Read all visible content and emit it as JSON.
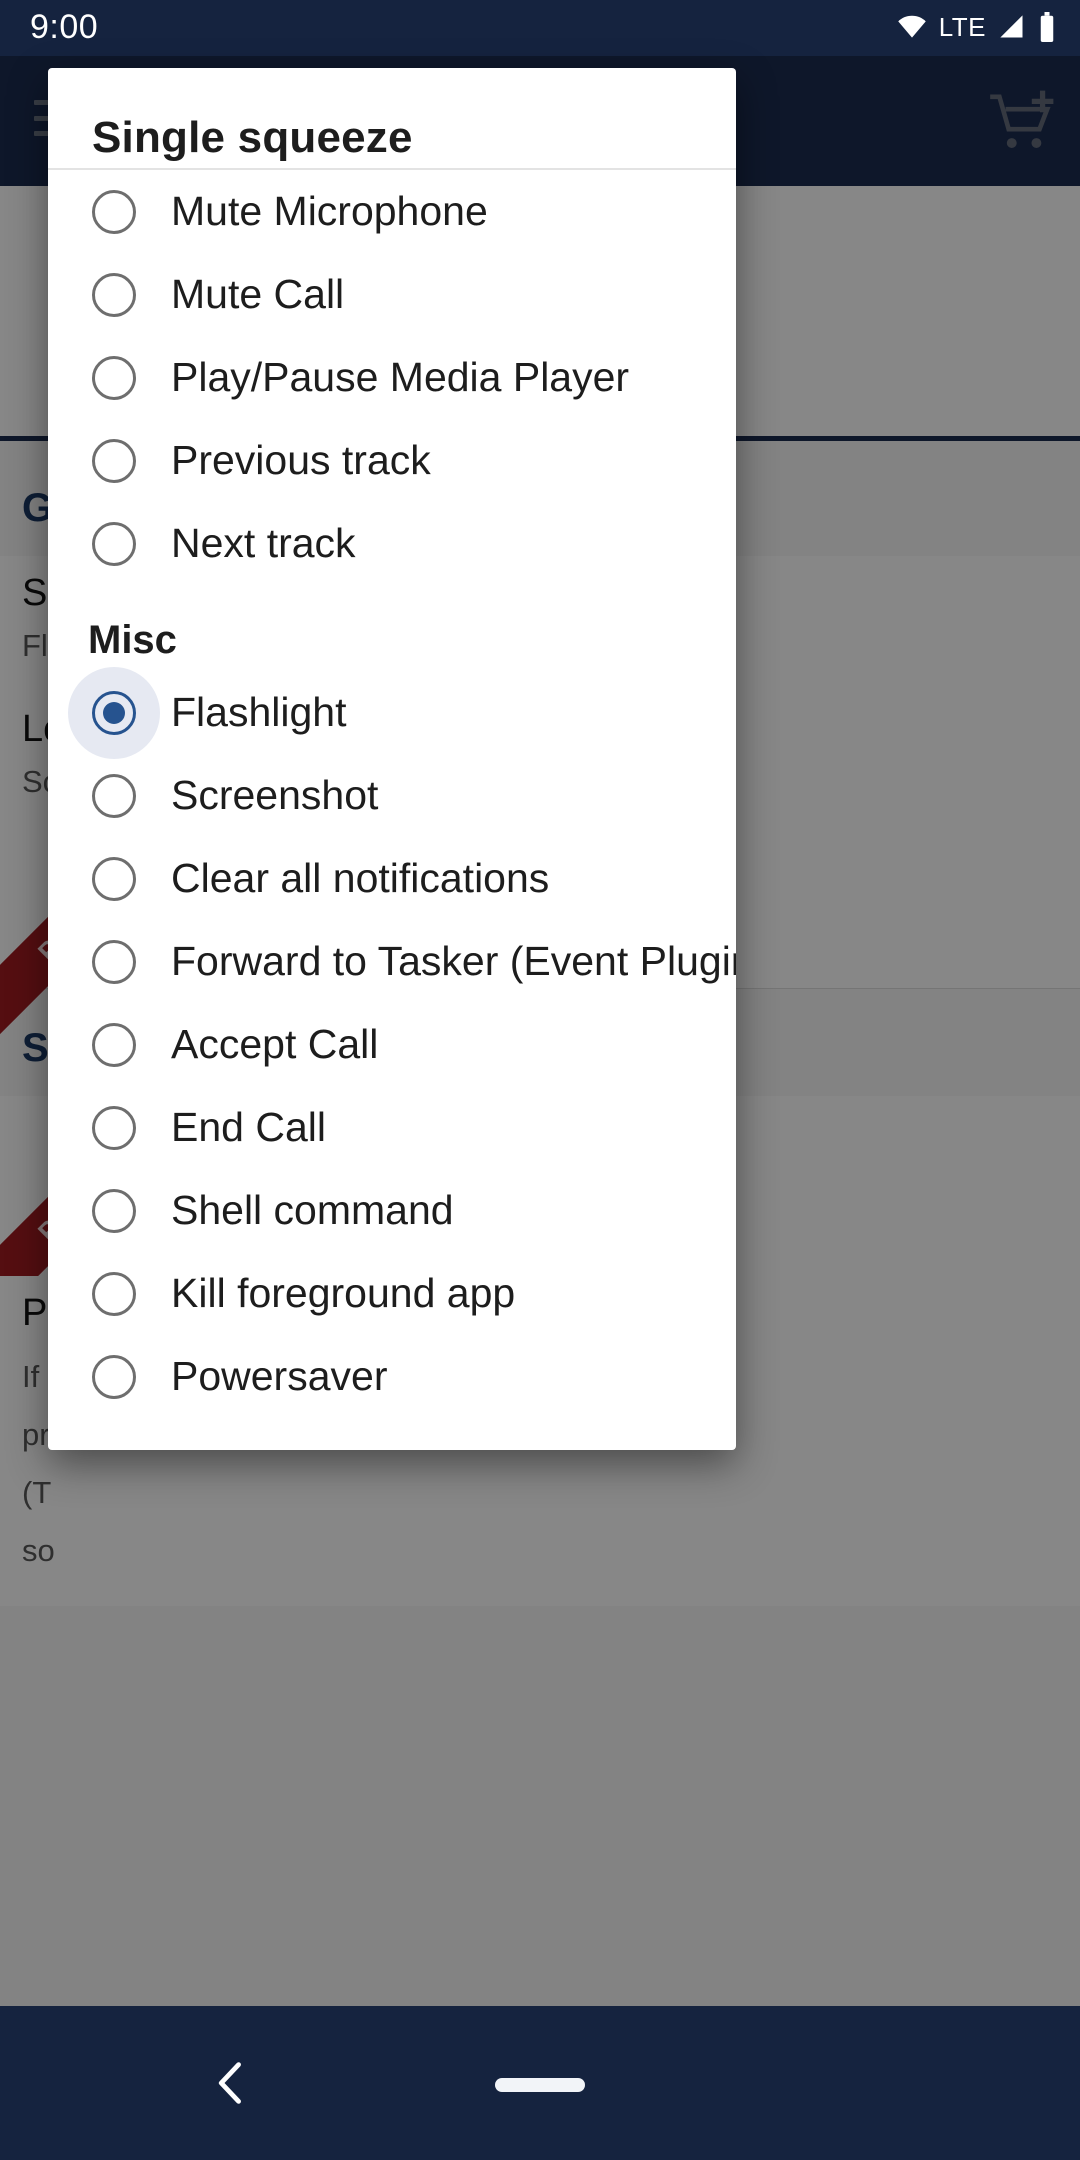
{
  "status_bar": {
    "time": "9:00",
    "network_label": "LTE",
    "icons": [
      "wifi-icon",
      "signal-icon",
      "battery-icon"
    ],
    "background_color": "#15233f"
  },
  "background_app": {
    "app_bar": {
      "menu_icon": "hamburger-menu-icon",
      "action_icon": "add-to-cart-icon",
      "background_color": "#1b2c50"
    },
    "sections": [
      {
        "header": "Ge",
        "rows": [
          {
            "title": "S",
            "subtitle": "Fl"
          },
          {
            "title": "Le",
            "subtitle": "Sc"
          },
          {
            "title": "",
            "subtitle": "",
            "badge": "PRO"
          }
        ]
      },
      {
        "header": "Se",
        "rows": [
          {
            "title": "",
            "subtitle": "",
            "badge": "PRO"
          },
          {
            "title": "P",
            "subtitle": "If"
          }
        ]
      }
    ],
    "paragraph_lines": [
      "If",
      "pr",
      "(T",
      "so"
    ],
    "badge_label": "PRO"
  },
  "dialog": {
    "title": "Single squeeze",
    "selected_option": "Flashlight",
    "groups": [
      {
        "header": null,
        "options": [
          {
            "label": "Mute Microphone",
            "selected": false
          },
          {
            "label": "Mute Call",
            "selected": false
          },
          {
            "label": "Play/Pause Media Player",
            "selected": false
          },
          {
            "label": "Previous track",
            "selected": false
          },
          {
            "label": "Next track",
            "selected": false
          }
        ]
      },
      {
        "header": "Misc",
        "options": [
          {
            "label": "Flashlight",
            "selected": true
          },
          {
            "label": "Screenshot",
            "selected": false
          },
          {
            "label": "Clear all notifications",
            "selected": false
          },
          {
            "label": "Forward to Tasker (Event Plugin)",
            "selected": false
          },
          {
            "label": "Accept Call",
            "selected": false
          },
          {
            "label": "End Call",
            "selected": false
          },
          {
            "label": "Shell command",
            "selected": false
          },
          {
            "label": "Kill foreground app",
            "selected": false
          },
          {
            "label": "Powersaver",
            "selected": false
          }
        ]
      }
    ],
    "accent_color": "#26538f",
    "radio_unselected_color": "#6e6e6e"
  },
  "nav_bar": {
    "back_icon": "back-chevron-icon",
    "home_indicator": "home-pill-icon",
    "background_color": "#15233f"
  }
}
